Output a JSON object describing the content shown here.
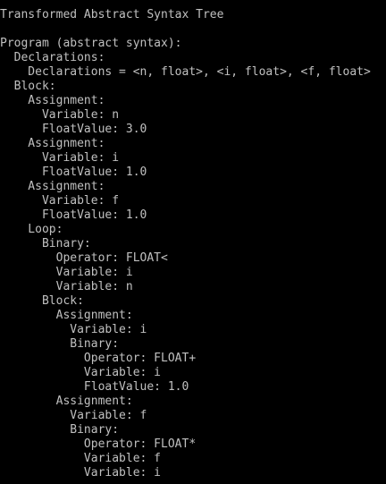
{
  "colors": {
    "background": "#000000",
    "text": "#c0c0c0"
  },
  "console": {
    "title": "Transformed Abstract Syntax Tree",
    "lines": [
      "Program (abstract syntax):",
      "  Declarations:",
      "    Declarations = <n, float>, <i, float>, <f, float>",
      "  Block:",
      "    Assignment:",
      "      Variable: n",
      "      FloatValue: 3.0",
      "    Assignment:",
      "      Variable: i",
      "      FloatValue: 1.0",
      "    Assignment:",
      "      Variable: f",
      "      FloatValue: 1.0",
      "    Loop:",
      "      Binary:",
      "        Operator: FLOAT<",
      "        Variable: i",
      "        Variable: n",
      "      Block:",
      "        Assignment:",
      "          Variable: i",
      "          Binary:",
      "            Operator: FLOAT+",
      "            Variable: i",
      "            FloatValue: 1.0",
      "        Assignment:",
      "          Variable: f",
      "          Binary:",
      "            Operator: FLOAT*",
      "            Variable: f",
      "            Variable: i"
    ]
  }
}
